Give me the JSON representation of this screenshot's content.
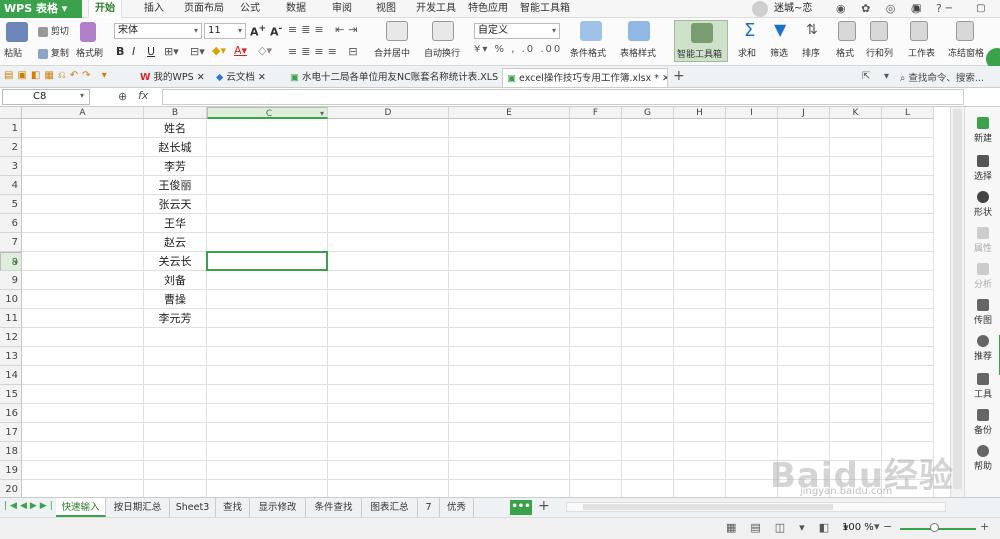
{
  "app": {
    "name": "WPS 表格",
    "brand_color": "#3aa24a"
  },
  "menu": {
    "items": [
      "开始",
      "插入",
      "页面布局",
      "公式",
      "数据",
      "审阅",
      "视图",
      "开发工具",
      "特色应用",
      "智能工具箱"
    ],
    "active": "开始",
    "user": "迷城~恋"
  },
  "ribbon": {
    "paste": "粘贴",
    "cut": "剪切",
    "copy": "复制",
    "format_painter": "格式刷",
    "font_name": "宋体",
    "font_size": "11",
    "bold": "B",
    "italic": "I",
    "underline": "U",
    "merge_center": "合并居中",
    "wrap_text": "自动换行",
    "number_format": "自定义",
    "conditional_format": "条件格式",
    "table_style": "表格样式",
    "smart_toolbox": "智能工具箱",
    "sum": "求和",
    "filter": "筛选",
    "sort": "排序",
    "format": "格式",
    "row_col": "行和列",
    "worksheet": "工作表",
    "freeze": "冻结窗格"
  },
  "doc_tabs": [
    {
      "label": "我的WPS"
    },
    {
      "label": "云文档"
    },
    {
      "label": "水电十二局各单位用友NC账套名称统计表.XLS"
    },
    {
      "label": "excel操作技巧专用工作簿.xlsx *"
    }
  ],
  "search": {
    "placeholder": "查找命令、搜索..."
  },
  "formula_bar": {
    "cell_ref": "C8",
    "fx": "fx",
    "value": ""
  },
  "grid": {
    "columns": [
      "A",
      "B",
      "C",
      "D",
      "E",
      "F",
      "G",
      "H",
      "I",
      "J",
      "K",
      "L"
    ],
    "rows": [
      "1",
      "2",
      "3",
      "4",
      "5",
      "6",
      "7",
      "8",
      "9",
      "10",
      "11",
      "12",
      "13",
      "14",
      "15",
      "16",
      "17",
      "18",
      "19",
      "20"
    ],
    "selected_column": "C",
    "selected_row": "8",
    "col_b_values": [
      "姓名",
      "赵长城",
      "李芳",
      "王俊丽",
      "张云天",
      "王华",
      "赵云",
      "关云长",
      "刘备",
      "曹操",
      "李元芳"
    ]
  },
  "side_panel": {
    "items": [
      "新建",
      "选择",
      "形状",
      "属性",
      "分析",
      "传图",
      "推荐",
      "工具",
      "备份",
      "帮助"
    ]
  },
  "sheet_tabs": {
    "items": [
      "快速输入",
      "按日期汇总",
      "Sheet3",
      "查找",
      "显示修改",
      "条件查找",
      "图表汇总",
      "7",
      "优秀"
    ],
    "active": "快速输入"
  },
  "status": {
    "zoom": "100 %"
  },
  "watermark": {
    "text": "Baidu经验",
    "sub": "jingyan.baidu.com"
  }
}
